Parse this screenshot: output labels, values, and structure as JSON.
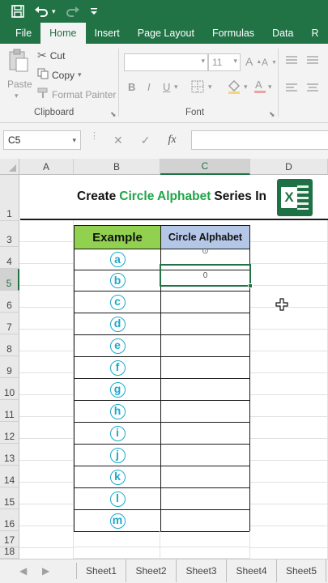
{
  "quick_access": {
    "save_icon": "save-icon",
    "undo_icon": "undo-icon",
    "redo_icon": "redo-icon",
    "customize_icon": "customize-qat-icon"
  },
  "ribbon_tabs": [
    "File",
    "Home",
    "Insert",
    "Page Layout",
    "Formulas",
    "Data",
    "R"
  ],
  "active_tab": "Home",
  "clipboard": {
    "paste_label": "Paste",
    "cut_label": "Cut",
    "copy_label": "Copy",
    "format_painter_label": "Format Painter",
    "group_label": "Clipboard"
  },
  "font": {
    "font_name": "",
    "font_size": "11",
    "bold": "B",
    "italic": "I",
    "underline": "U",
    "group_label": "Font"
  },
  "formula_bar": {
    "name_box": "C5",
    "cancel_symbol": "✕",
    "enter_symbol": "✓",
    "fx_label": "fx",
    "content": ""
  },
  "columns": [
    "A",
    "B",
    "C",
    "D"
  ],
  "selected_column": "C",
  "rows": [
    "1",
    "3",
    "4",
    "5",
    "6",
    "7",
    "8",
    "9",
    "10",
    "11",
    "12",
    "13",
    "14",
    "15",
    "16",
    "17",
    "18"
  ],
  "selected_row": "5",
  "sheet": {
    "title_part1": "Create",
    "title_highlight": "Circle Alphabet",
    "title_part2": "Series In",
    "logo_letter": "X",
    "header_example": "Example",
    "header_result": "Circle Alphabet",
    "examples": [
      "a",
      "b",
      "c",
      "d",
      "e",
      "f",
      "g",
      "h",
      "i",
      "j",
      "k",
      "l",
      "m"
    ],
    "c4_value": "",
    "c5_value": "0"
  },
  "sheet_tabs": [
    "Sheet1",
    "Sheet2",
    "Sheet3",
    "Sheet4",
    "Sheet5"
  ],
  "colors": {
    "excel_green": "#217346",
    "example_header_bg": "#92d050",
    "result_header_bg": "#b4c7e7",
    "circle_letters": "#1ba9c9",
    "title_highlight": "#1fa446"
  }
}
